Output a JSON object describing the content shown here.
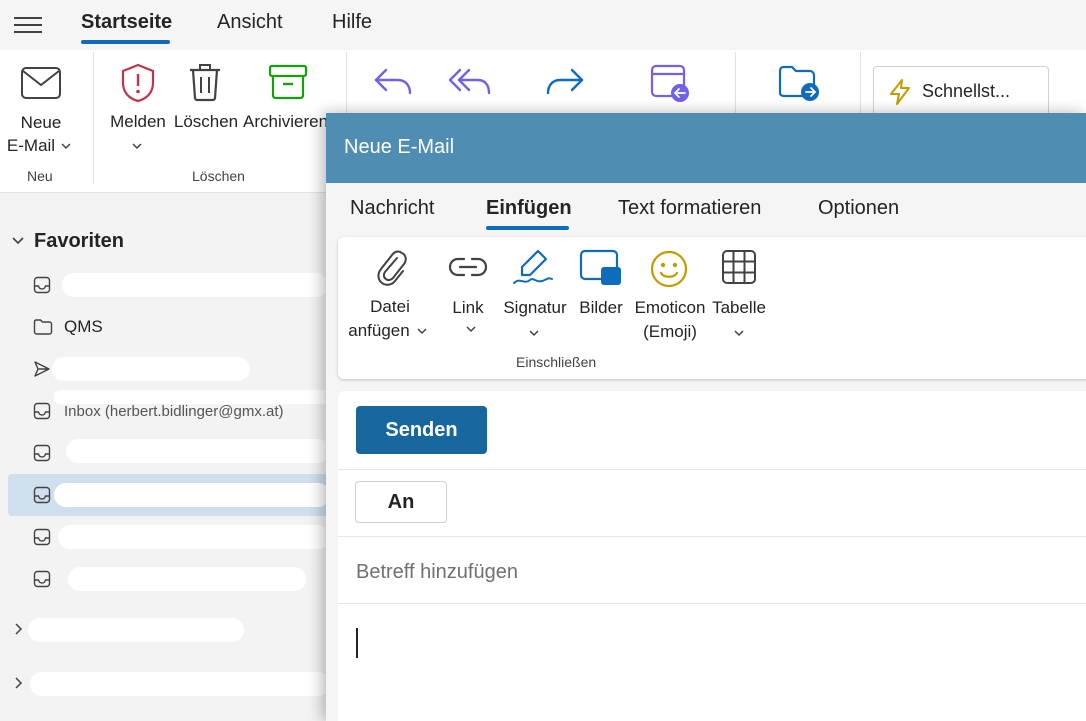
{
  "menu": {
    "tabs": [
      {
        "label": "Startseite",
        "active": true
      },
      {
        "label": "Ansicht",
        "active": false
      },
      {
        "label": "Hilfe",
        "active": false
      }
    ]
  },
  "ribbon": {
    "new_label_1": "Neue",
    "new_label_2": "E-Mail",
    "report_label": "Melden",
    "delete_label": "Löschen",
    "archive_label": "Archivieren",
    "group_new": "Neu",
    "group_delete": "Löschen",
    "quick_steps_label": "Schnellst...",
    "icons": [
      "mail-icon",
      "shield-icon",
      "trash-icon",
      "archive-icon",
      "reply-icon",
      "reply-all-icon",
      "forward-icon",
      "calendar-reply-icon",
      "move-to-folder-icon",
      "lightning-icon"
    ],
    "colors": {
      "report": "#c4314b",
      "archive": "#13a10e",
      "blue": "#0f6cbd",
      "purple": "#7160e8",
      "quick": "#c19c00"
    }
  },
  "nav": {
    "favorites_label": "Favoriten",
    "folder_qms": "QMS",
    "partial_text": "Inbox (herbert.bidlinger@gmx.at)"
  },
  "compose": {
    "title": "Neue E-Mail",
    "tabs": [
      {
        "label": "Nachricht",
        "active": false
      },
      {
        "label": "Einfügen",
        "active": true
      },
      {
        "label": "Text formatieren",
        "active": false
      },
      {
        "label": "Optionen",
        "active": false
      }
    ],
    "insert": {
      "attach_1": "Datei",
      "attach_2": "anfügen",
      "link": "Link",
      "signature": "Signatur",
      "pictures": "Bilder",
      "emoticon_1": "Emoticon",
      "emoticon_2": "(Emoji)",
      "table": "Tabelle",
      "group": "Einschließen"
    },
    "send_label": "Senden",
    "to_label": "An",
    "subject_placeholder": "Betreff hinzufügen",
    "accent": "#4f8db3"
  }
}
